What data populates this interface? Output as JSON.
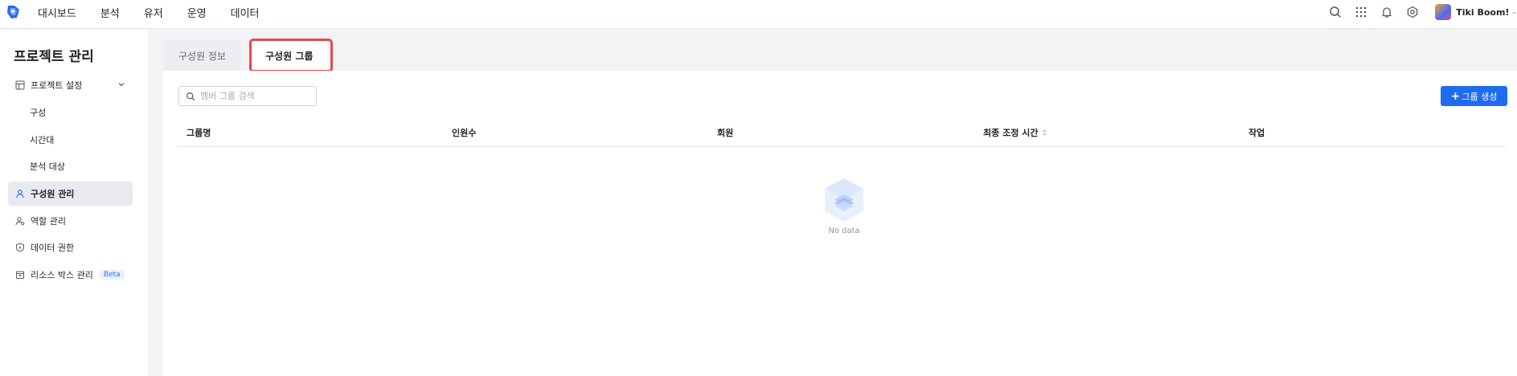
{
  "nav": {
    "items": [
      "대시보드",
      "분석",
      "유저",
      "운영",
      "데이터"
    ]
  },
  "user": {
    "name": "Tiki Boom!"
  },
  "sidebar": {
    "title": "프로젝트 관리",
    "project_settings": "프로젝트 설정",
    "config": "구성",
    "timezone": "시간대",
    "analysis_target": "분석 대상",
    "member_mgmt": "구성원 관리",
    "role_mgmt": "역할 관리",
    "data_permission": "데이터 권한",
    "resource_box": "리소스 박스 관리",
    "beta": "Beta"
  },
  "tabs": {
    "member_info": "구성원 정보",
    "member_group": "구성원 그룹"
  },
  "search": {
    "placeholder": "멤버 그룹 검색"
  },
  "actions": {
    "create_group": "그룹 생성"
  },
  "table": {
    "columns": [
      "그룹명",
      "인원수",
      "회원",
      "최종 조정 시간",
      "작업"
    ]
  },
  "empty": {
    "text": "No data"
  },
  "colors": {
    "primary": "#1f6cf3",
    "highlight": "#e5484d"
  }
}
